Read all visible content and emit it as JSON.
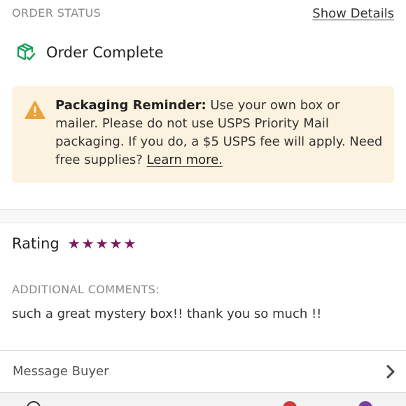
{
  "order_status": {
    "label": "ORDER STATUS",
    "show_details": "Show Details",
    "status_text": "Order Complete"
  },
  "packaging_reminder": {
    "title": "Packaging Reminder:",
    "body": "Use your own box or mailer. Please do not use USPS Priority Mail packaging. If you do, a $5 USPS fee will apply. Need free supplies?",
    "link": "Learn more."
  },
  "rating": {
    "label": "Rating",
    "stars": 5,
    "star_color": "#7a1a5e"
  },
  "comments": {
    "label": "ADDITIONAL COMMENTS:",
    "text": "such a great mystery box!! thank you so much !!"
  },
  "message_buyer": {
    "label": "Message Buyer"
  },
  "colors": {
    "status_icon": "#1aa05a",
    "alert_background": "#fcf2e0",
    "warning_icon": "#e8a33d"
  }
}
